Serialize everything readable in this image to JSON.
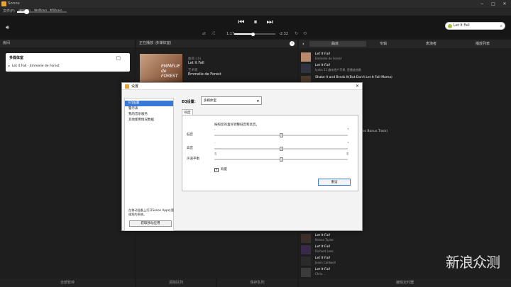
{
  "window": {
    "title": "Sonos",
    "controls": [
      "−",
      "□",
      "✕"
    ]
  },
  "menu": [
    "文件(F)",
    "编辑(E)",
    "管理(M)",
    "帮助(H)"
  ],
  "transport": {
    "volume_percent": 18,
    "elapsed": "1:17",
    "total": "-2:32",
    "progress_percent": 45
  },
  "search": {
    "query": "Let It Fall"
  },
  "columns": {
    "rooms": "房间",
    "now_playing": "正在播放 (多媒体室)"
  },
  "room_card": {
    "title": "多媒体室",
    "track": "Let It Fall - Emmelie de Forest"
  },
  "album": {
    "text": "EMMELIE de FOREST"
  },
  "now_playing": {
    "src_label": "曲目 (小)",
    "track": "Let It Fall",
    "artist_label": "艺术家",
    "artist": "Emmelie de Forest"
  },
  "tabs": [
    "曲目",
    "专辑",
    "表演者",
    "播放列表"
  ],
  "right_list": [
    {
      "title": "Let It Fall",
      "artist": "Emmelie de Forest"
    },
    {
      "title": "Let It Fall",
      "artist": "Iyaka 11 趣味把产苹果, 是播放曲歌"
    },
    {
      "title": "Shake It and Break It(But Don't Let It Fall Mama)",
      "artist": ""
    }
  ],
  "right_frag": "es Bonus Track)",
  "bottom_list": [
    {
      "title": "Let It Fall",
      "artist": "Kelsea Taylor"
    },
    {
      "title": "Let It Fall",
      "artist": "Richard Lees"
    },
    {
      "title": "Let It Fall",
      "artist": "Jason Caldwell"
    },
    {
      "title": "Let It Fall",
      "artist": "Chris..."
    }
  ],
  "bottom": [
    "全部暂停",
    "清除队列",
    "保存队列",
    "编辑定时器"
  ],
  "dialog": {
    "title": "设置",
    "sidebar": [
      "EQ设置",
      "警示表",
      "我的音乐服务",
      "其他使用情况数据"
    ],
    "sidebar_note": "在移动设备上打开Sonos App以管理您的系统。",
    "sidebar_btn": "获取移动应用",
    "eq_label": "EQ设置：",
    "eq_value": "多媒体室",
    "subtab": "响度",
    "desc": "按照您的喜好调整低音和高音。",
    "sliders": [
      {
        "label": "低音",
        "value": 0
      },
      {
        "label": "高音",
        "value": 0
      },
      {
        "label": "声道平衡",
        "value": 0
      }
    ],
    "balance_ticks": [
      "左",
      "右"
    ],
    "loudness": "响度",
    "loudness_checked": true,
    "reset": "重设"
  },
  "watermark": "新浪众测"
}
